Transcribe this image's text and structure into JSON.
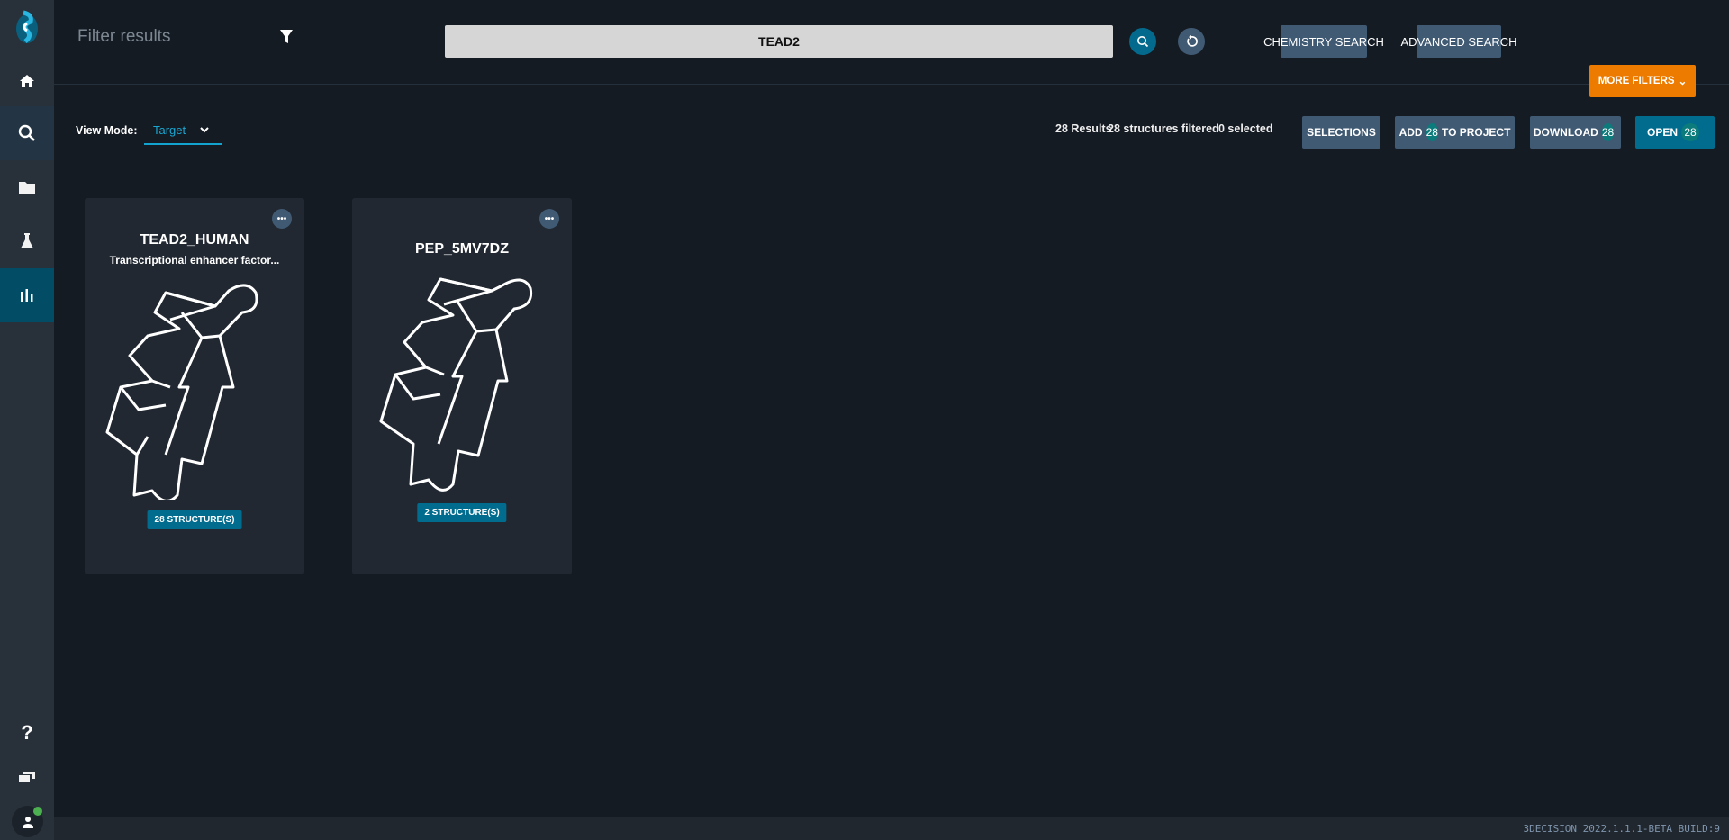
{
  "sidebar": {
    "items": [
      {
        "name": "home",
        "icon": "home-icon"
      },
      {
        "name": "search",
        "icon": "search-icon"
      },
      {
        "name": "projects",
        "icon": "folder-icon"
      },
      {
        "name": "chemistry",
        "icon": "flask-icon"
      },
      {
        "name": "analytics",
        "icon": "bar-chart-icon"
      }
    ],
    "bottom": [
      {
        "icon": "help-icon",
        "label": "?"
      },
      {
        "icon": "windows-icon"
      },
      {
        "icon": "user-icon"
      }
    ]
  },
  "header": {
    "filter_placeholder": "Filter results",
    "search_value": "TEAD2",
    "chemistry_search": "CHEMISTRY SEARCH",
    "advanced_search": "ADVANCED SEARCH",
    "more_filters": "MORE FILTERS"
  },
  "toolbar": {
    "view_mode_label": "View Mode:",
    "view_mode_value": "Target",
    "results": "28 Results",
    "filtered": "28 structures filtered",
    "selected": "0 selected",
    "selections": "SELECTIONS",
    "add_prefix": "ADD",
    "add_count": "28",
    "add_suffix": "TO PROJECT",
    "download": "DOWNLOAD",
    "download_count": "28",
    "open": "OPEN",
    "open_count": "28"
  },
  "cards": [
    {
      "title": "TEAD2_HUMAN",
      "subtitle": "Transcriptional enhancer factor...",
      "structures": "28 STRUCTURE(S)",
      "more": "•••"
    },
    {
      "title": "PEP_5MV7DZ",
      "subtitle": "",
      "structures": "2 STRUCTURE(S)",
      "more": "•••"
    }
  ],
  "colors": {
    "accent": "#026c8f",
    "orange": "#ec7b00",
    "active_sidebar": "#024c66",
    "status_online": "#4caf50"
  },
  "footer": {
    "version": "3DECISION 2022.1.1.1-BETA BUILD:9"
  }
}
